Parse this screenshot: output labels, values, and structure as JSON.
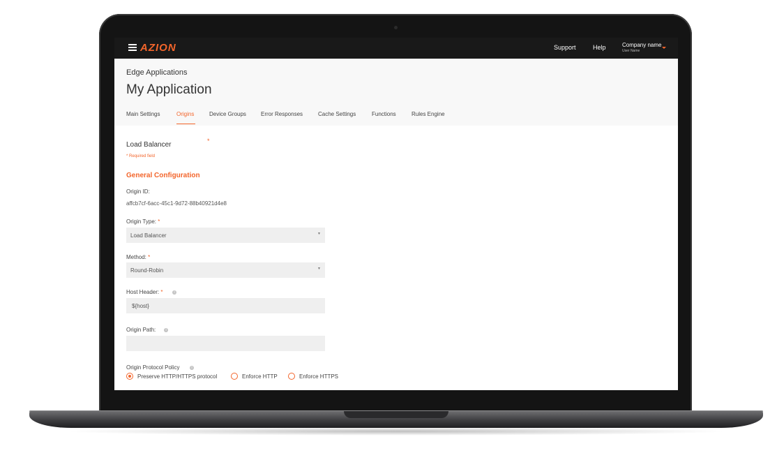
{
  "brand": {
    "logo": "AZION",
    "accent": "#f3652b"
  },
  "topbar": {
    "support": "Support",
    "help": "Help",
    "company_name": "Company name",
    "user_name": "User Name"
  },
  "header": {
    "breadcrumb": "Edge Applications",
    "title": "My Application"
  },
  "tabs": [
    {
      "label": "Main Settings"
    },
    {
      "label": "Origins",
      "active": true
    },
    {
      "label": "Device Groups"
    },
    {
      "label": "Error Responses"
    },
    {
      "label": "Cache Settings"
    },
    {
      "label": "Functions"
    },
    {
      "label": "Rules Engine"
    }
  ],
  "form": {
    "section_title": "Load Balancer",
    "required_star": "*",
    "required_note": "* Required field",
    "general_config": "General Configuration",
    "origin_id_label": "Origin ID:",
    "origin_id_value": "affcb7cf-6acc-45c1-9d72-88b40921d4e8",
    "origin_type_label": "Origin Type:",
    "origin_type_value": "Load Balancer",
    "method_label": "Method:",
    "method_value": "Round-Robin",
    "host_header_label": "Host Header:",
    "host_header_value": "${host}",
    "origin_path_label": "Origin Path:",
    "origin_path_value": "",
    "protocol_policy_label": "Origin Protocol Policy",
    "protocol_options": [
      {
        "label": "Preserve HTTP/HTTPS protocol",
        "checked": true
      },
      {
        "label": "Enforce HTTP",
        "checked": false
      },
      {
        "label": "Enforce HTTPS",
        "checked": false
      }
    ]
  }
}
